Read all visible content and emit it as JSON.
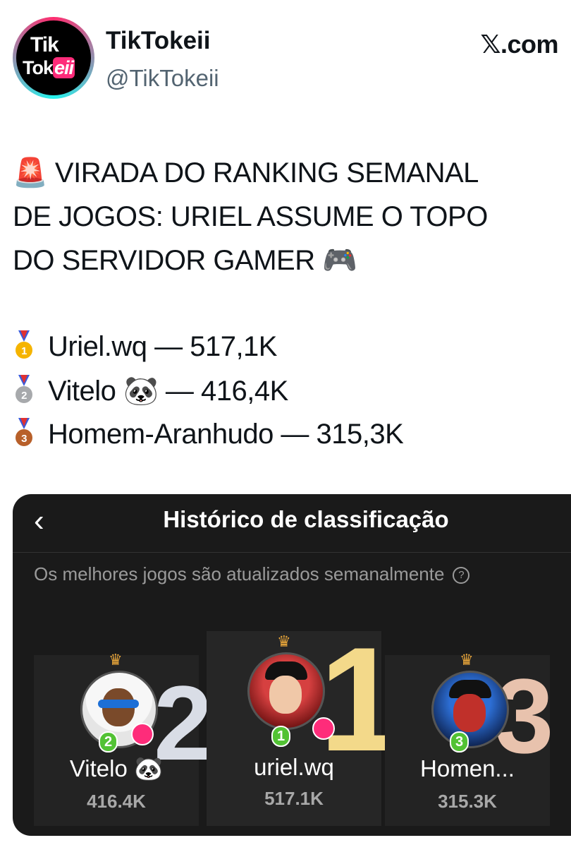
{
  "account": {
    "display_name": "TikTokeii",
    "handle": "@TikTokeii",
    "avatar_logo_line1": "Tik",
    "avatar_logo_line2a": "Tok",
    "avatar_logo_line2b": "eii",
    "source": "𝕏.com"
  },
  "post": {
    "headline_lines": [
      "🚨 VIRADA DO RANKING SEMANAL",
      "DE JOGOS: URIEL ASSUME O TOPO",
      "DO SERVIDOR GAMER 🎮"
    ],
    "ranking": [
      {
        "medal": "gold",
        "number": "1",
        "text": "Uriel.wq — 517,1K"
      },
      {
        "medal": "silver",
        "number": "2",
        "text": "Vitelo 🐼 — 416,4K"
      },
      {
        "medal": "bronze",
        "number": "3",
        "text": "Homem-Aranhudo — 315,3K"
      }
    ]
  },
  "card": {
    "back_icon": "‹",
    "title": "Histórico de classificação",
    "subtitle": "Os melhores jogos são atualizados semanalmente",
    "help_icon": "?",
    "podium": [
      {
        "place": "2",
        "badge": "2",
        "name": "Vitelo 🐼",
        "score": "416.4K"
      },
      {
        "place": "1",
        "badge": "1",
        "name": "uriel.wq",
        "score": "517.1K"
      },
      {
        "place": "3",
        "badge": "3",
        "name": "Homen...",
        "score": "315.3K"
      }
    ]
  },
  "colors": {
    "medal_gold": "#f5b400",
    "medal_silver": "#a7a9ac",
    "medal_bronze": "#b8602a",
    "accent_pink": "#fe2c7a",
    "accent_cyan": "#25f4ee",
    "card_bg": "#1a1a1a"
  }
}
